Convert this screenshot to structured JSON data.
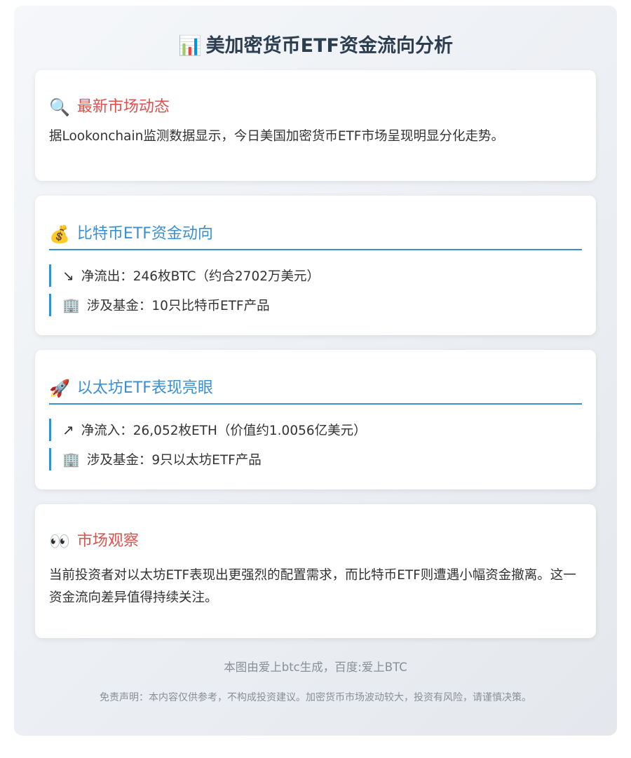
{
  "header": {
    "icon": "📊",
    "icon_name": "bar-chart-icon",
    "title": "美加密货币ETF资金流向分析"
  },
  "latest": {
    "icon": "🔍",
    "heading": "最新市场动态",
    "text": "据Lookonchain监测数据显示，今日美国加密货币ETF市场呈现明显分化走势。"
  },
  "btc": {
    "icon": "💰",
    "heading": "比特币ETF资金动向",
    "items": [
      {
        "icon": "↘",
        "text": "净流出：246枚BTC（约合2702万美元）"
      },
      {
        "icon": "🏢",
        "text": "涉及基金：10只比特币ETF产品"
      }
    ]
  },
  "eth": {
    "icon": "🚀",
    "heading": "以太坊ETF表现亮眼",
    "items": [
      {
        "icon": "↗",
        "text": "净流入：26,052枚ETH（价值约1.0056亿美元）"
      },
      {
        "icon": "🏢",
        "text": "涉及基金：9只以太坊ETF产品"
      }
    ]
  },
  "observation": {
    "icon": "👀",
    "heading": "市场观察",
    "text": "当前投资者对以太坊ETF表现出更强烈的配置需求，而比特币ETF则遭遇小幅资金撤离。这一资金流向差异值得持续关注。"
  },
  "footer": {
    "credit": "本图由爱上btc生成，百度:爱上BTC",
    "disclaimer": "免责声明：本内容仅供参考，不构成投资建议。加密货币市场波动较大，投资有风险，请谨慎决策。"
  },
  "colors": {
    "accent_blue": "#3a8fd0",
    "accent_red": "#d9534f",
    "title": "#2c3e50"
  }
}
